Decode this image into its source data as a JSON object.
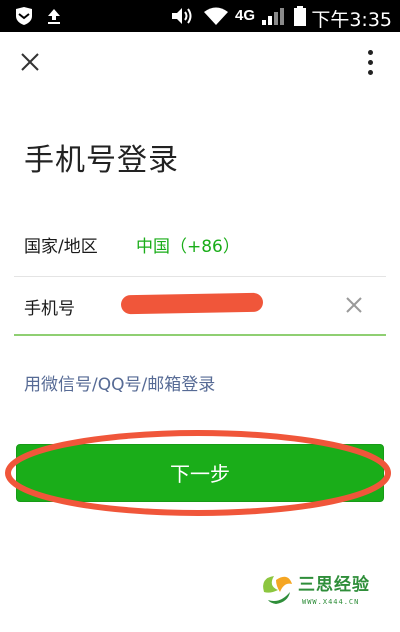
{
  "status_bar": {
    "network": "4G",
    "time": "下午3:35"
  },
  "toolbar": {
    "close_icon": "close-icon",
    "more_icon": "more-vertical-icon"
  },
  "page": {
    "title": "手机号登录"
  },
  "form": {
    "country_label": "国家/地区",
    "country_value": "中国（+86）",
    "phone_label": "手机号",
    "phone_value": "",
    "clear_icon": "clear-icon"
  },
  "links": {
    "alt_login": "用微信号/QQ号/邮箱登录"
  },
  "buttons": {
    "next_label": "下一步"
  },
  "watermark": {
    "title": "三思经验",
    "url": "WWW.X444.CN"
  },
  "colors": {
    "accent_green": "#1aad19",
    "link_blue": "#576b95",
    "annotation_orange": "#f0563a"
  }
}
